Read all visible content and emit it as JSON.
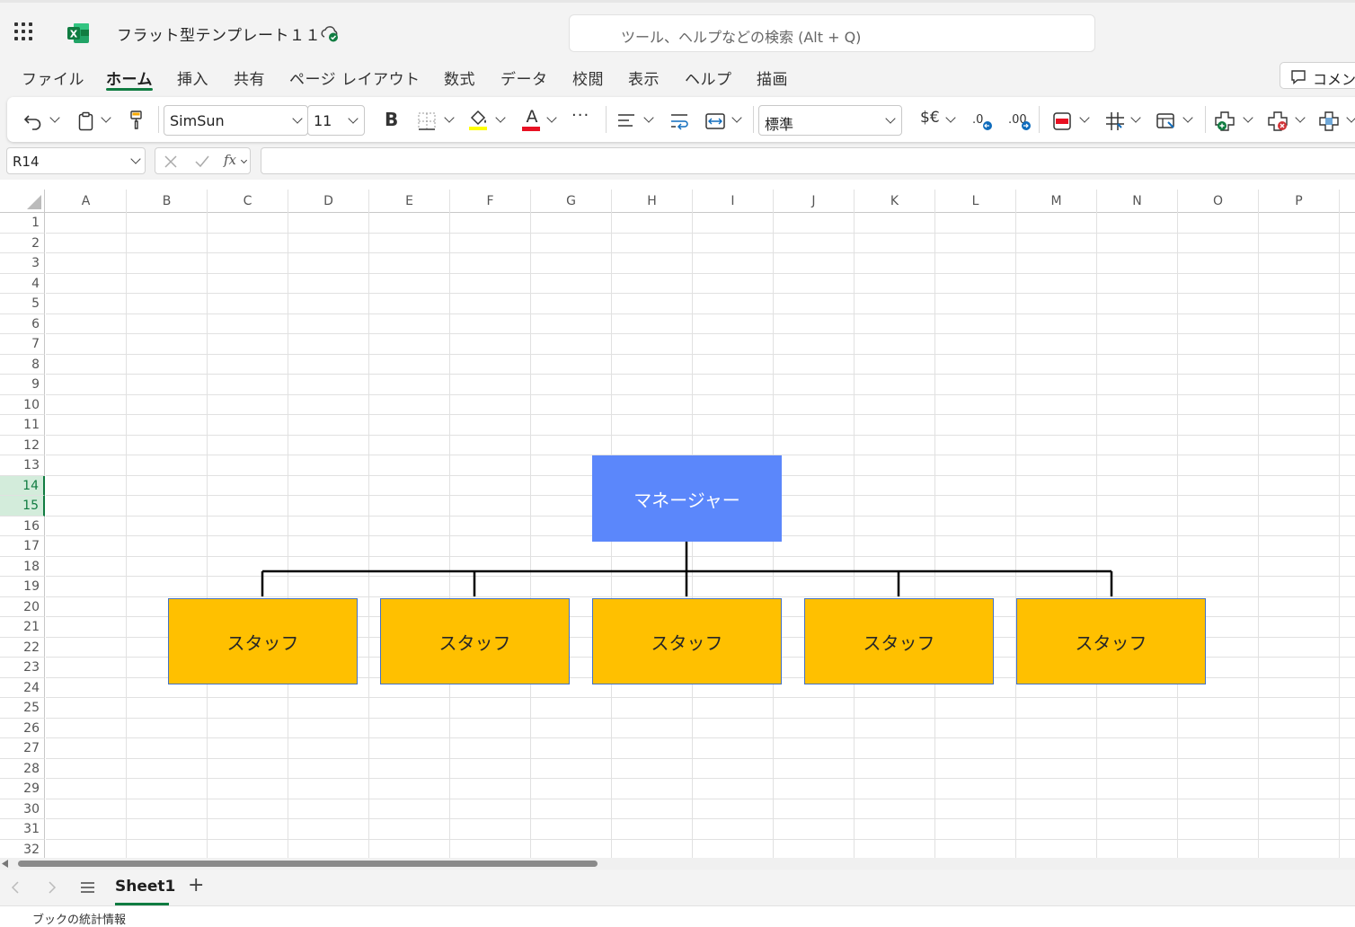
{
  "app": {
    "doc_title": "フラット型テンプレート１１",
    "search_placeholder": "ツール、ヘルプなどの検索 (Alt + Q)"
  },
  "menu": {
    "tabs": [
      "ファイル",
      "ホーム",
      "挿入",
      "共有",
      "ページ レイアウト",
      "数式",
      "データ",
      "校閲",
      "表示",
      "ヘルプ",
      "描画"
    ],
    "active": "ホーム",
    "comment_label": "コメン"
  },
  "ribbon": {
    "font_name": "SimSun",
    "font_size": "11",
    "number_format": "標準",
    "currency_label": "$€",
    "bold_label": "B",
    "font_color_label": "A",
    "more_label": "···",
    "font_color": "#e81123",
    "highlight_color": "#ffff00"
  },
  "formula_bar": {
    "name_box": "R14",
    "fx_label": "fx",
    "formula": ""
  },
  "grid": {
    "columns": [
      "A",
      "B",
      "C",
      "D",
      "E",
      "F",
      "G",
      "H",
      "I",
      "J",
      "K",
      "L",
      "M",
      "N",
      "O",
      "P"
    ],
    "rows": [
      "1",
      "2",
      "3",
      "4",
      "5",
      "6",
      "7",
      "8",
      "9",
      "10",
      "11",
      "12",
      "13",
      "14",
      "15",
      "16",
      "17",
      "18",
      "19",
      "20",
      "21",
      "22",
      "23",
      "24",
      "25",
      "26",
      "27",
      "28",
      "29",
      "30",
      "31",
      "32"
    ],
    "selected_rows": [
      "14",
      "15"
    ]
  },
  "org_chart": {
    "manager": {
      "label": "マネージャー",
      "color": "#5b87fb",
      "text_color": "#ffffff"
    },
    "staff": [
      {
        "label": "スタッフ"
      },
      {
        "label": "スタッフ"
      },
      {
        "label": "スタッフ"
      },
      {
        "label": "スタッフ"
      },
      {
        "label": "スタッフ"
      }
    ],
    "staff_color": "#ffc000",
    "staff_border": "#4472c4"
  },
  "sheets": {
    "tabs": [
      "Sheet1"
    ],
    "active": "Sheet1",
    "add_label": "+"
  },
  "status": {
    "text": "ブックの統計情報"
  },
  "colors": {
    "accent": "#107c41",
    "chrome_bg": "#f3f3f3"
  }
}
